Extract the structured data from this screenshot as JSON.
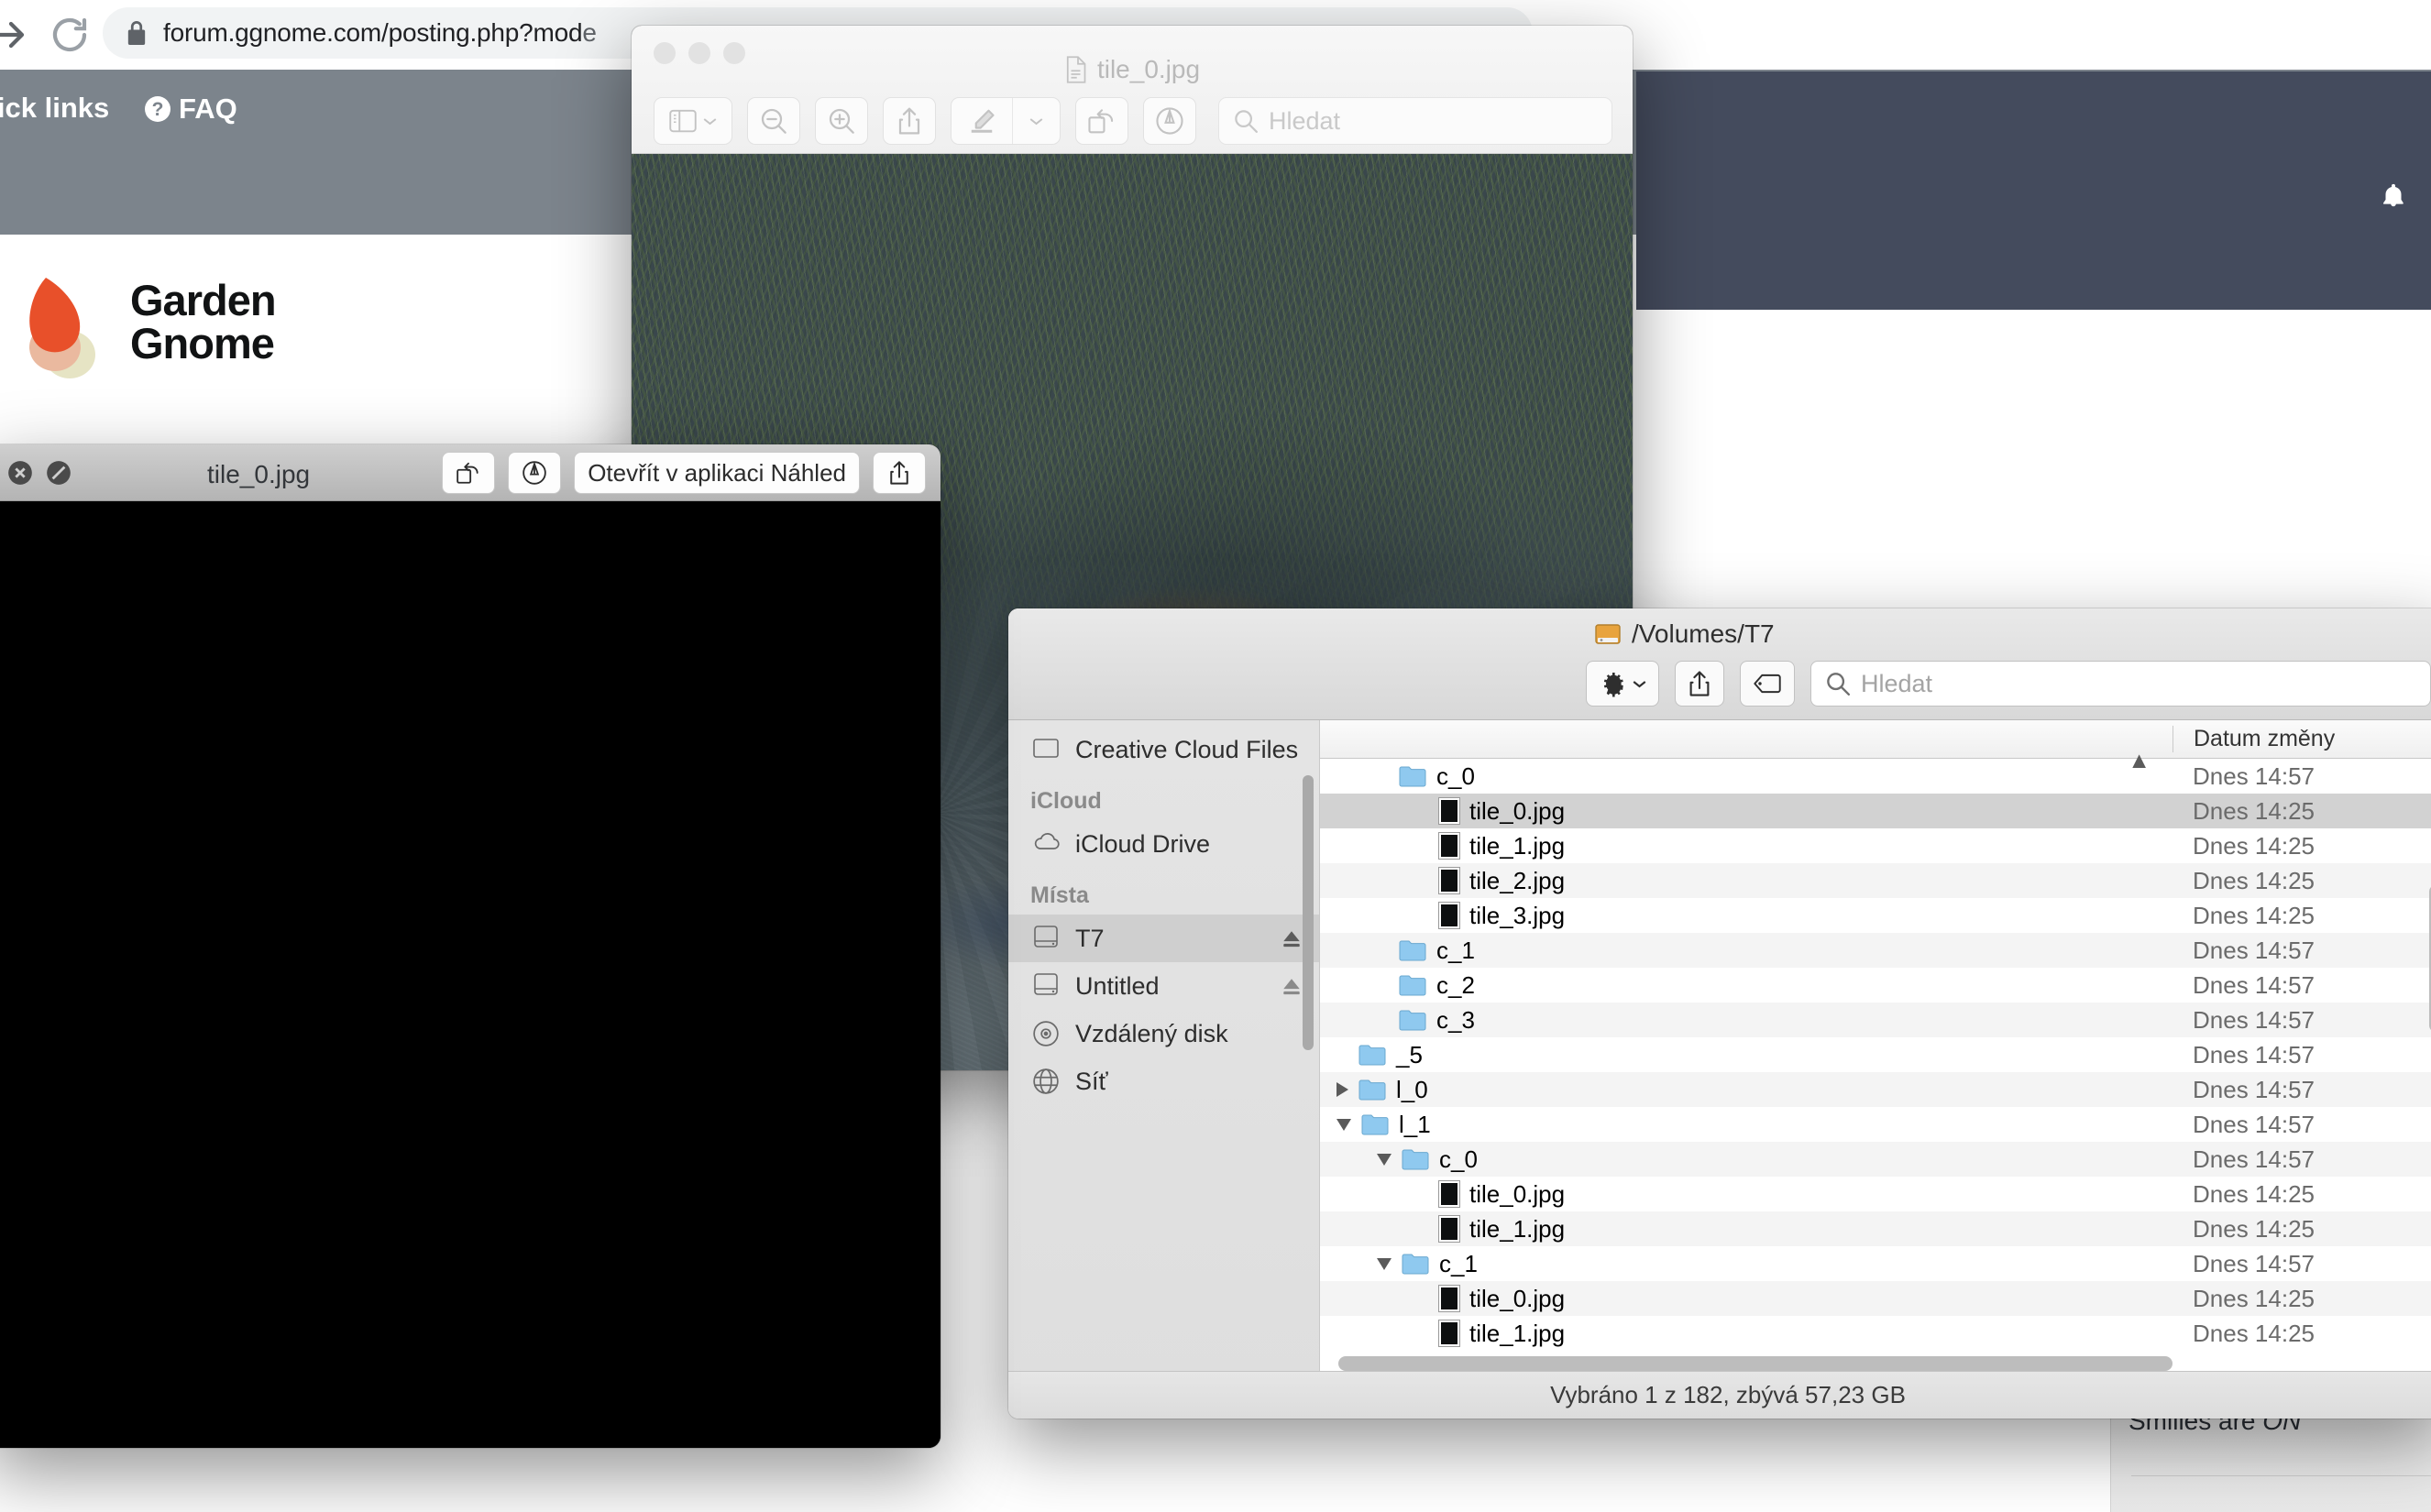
{
  "browser": {
    "url_bold": "forum.ggnome.com/posting.php?mod",
    "url_dim": "e",
    "lock_icon": "lock-icon",
    "forward_icon": "forward-arrow-icon",
    "reload_icon": "reload-icon"
  },
  "forum": {
    "quick_links": "uick links",
    "faq": "FAQ",
    "faq_badge": "?",
    "brand_line1": "Garden",
    "brand_line2": "Gnome",
    "bell_icon": "bell-icon",
    "smilies_prefix": "Smilies are ",
    "smilies_state": "ON"
  },
  "preview": {
    "title": "tile_0.jpg",
    "doc_icon": "document-icon",
    "traffic_lights": [
      "close",
      "minimize",
      "zoom"
    ],
    "toolbar": [
      {
        "name": "sidebar-view-button",
        "icon": "sidebar-icon",
        "caret": true
      },
      {
        "name": "zoom-out-button",
        "icon": "magnifier-minus-icon",
        "caret": false
      },
      {
        "name": "zoom-in-button",
        "icon": "magnifier-plus-icon",
        "caret": false
      },
      {
        "name": "share-button",
        "icon": "share-icon",
        "caret": false
      },
      {
        "name": "markup-button",
        "icon": "markup-pen-icon",
        "caret": true
      },
      {
        "name": "rotate-button",
        "icon": "rotate-left-icon",
        "caret": false
      },
      {
        "name": "annotate-button",
        "icon": "annotate-circle-icon",
        "caret": false
      }
    ],
    "search_placeholder": "Hledat",
    "search_icon": "search-icon"
  },
  "quicklook": {
    "title": "tile_0.jpg",
    "close_icon": "close-icon",
    "fullscreen_icon": "no-entry-icon",
    "rotate_icon": "rotate-left-icon",
    "markup_icon": "markup-pen-icon",
    "open_button": "Otevřít v aplikaci Náhled",
    "share_icon": "share-icon"
  },
  "finder": {
    "title": "/Volumes/T7",
    "drive_icon": "external-drive-icon",
    "toolbar": [
      {
        "name": "action-gear-button",
        "icon": "gear-icon",
        "caret": true
      },
      {
        "name": "share-button",
        "icon": "share-icon",
        "caret": false
      },
      {
        "name": "tag-button",
        "icon": "tag-icon",
        "caret": false
      }
    ],
    "search_placeholder": "Hledat",
    "search_icon": "search-icon",
    "columns": {
      "name": "",
      "name_sort_arrow": "▲",
      "date": "Datum změny"
    },
    "sidebar": [
      {
        "section": null,
        "label": "Creative Cloud Files",
        "icon": "folder-plain-icon",
        "selected": false,
        "eject": false
      },
      {
        "section": "iCloud",
        "label": null,
        "icon": null,
        "selected": false,
        "eject": false
      },
      {
        "section": null,
        "label": "iCloud Drive",
        "icon": "cloud-icon",
        "selected": false,
        "eject": false
      },
      {
        "section": "Místa",
        "label": null,
        "icon": null,
        "selected": false,
        "eject": false
      },
      {
        "section": null,
        "label": "T7",
        "icon": "drive-icon",
        "selected": true,
        "eject": true
      },
      {
        "section": null,
        "label": "Untitled",
        "icon": "drive-icon",
        "selected": false,
        "eject": true
      },
      {
        "section": null,
        "label": "Vzdálený disk",
        "icon": "disc-icon",
        "selected": false,
        "eject": false
      },
      {
        "section": null,
        "label": "Síť",
        "icon": "globe-icon",
        "selected": false,
        "eject": false
      }
    ],
    "rows": [
      {
        "name": "c_0",
        "date": "Dnes 14:57",
        "kind": "folder",
        "indent": 1,
        "twisty": "none",
        "selected": false
      },
      {
        "name": "tile_0.jpg",
        "date": "Dnes 14:25",
        "kind": "jpg",
        "indent": 2,
        "twisty": "none",
        "selected": true
      },
      {
        "name": "tile_1.jpg",
        "date": "Dnes 14:25",
        "kind": "jpg",
        "indent": 2,
        "twisty": "none",
        "selected": false
      },
      {
        "name": "tile_2.jpg",
        "date": "Dnes 14:25",
        "kind": "jpg",
        "indent": 2,
        "twisty": "none",
        "selected": false
      },
      {
        "name": "tile_3.jpg",
        "date": "Dnes 14:25",
        "kind": "jpg",
        "indent": 2,
        "twisty": "none",
        "selected": false
      },
      {
        "name": "c_1",
        "date": "Dnes 14:57",
        "kind": "folder",
        "indent": 1,
        "twisty": "none",
        "selected": false
      },
      {
        "name": "c_2",
        "date": "Dnes 14:57",
        "kind": "folder",
        "indent": 1,
        "twisty": "none",
        "selected": false
      },
      {
        "name": "c_3",
        "date": "Dnes 14:57",
        "kind": "folder",
        "indent": 1,
        "twisty": "none",
        "selected": false
      },
      {
        "name": "_5",
        "date": "Dnes 14:57",
        "kind": "folder",
        "indent": 0,
        "twisty": "none",
        "selected": false
      },
      {
        "name": "l_0",
        "date": "Dnes 14:57",
        "kind": "folder",
        "indent": 0,
        "twisty": "closed",
        "selected": false
      },
      {
        "name": "l_1",
        "date": "Dnes 14:57",
        "kind": "folder",
        "indent": 0,
        "twisty": "open",
        "selected": false
      },
      {
        "name": "c_0",
        "date": "Dnes 14:57",
        "kind": "folder",
        "indent": 1,
        "twisty": "open",
        "selected": false
      },
      {
        "name": "tile_0.jpg",
        "date": "Dnes 14:25",
        "kind": "jpg",
        "indent": 2,
        "twisty": "none",
        "selected": false
      },
      {
        "name": "tile_1.jpg",
        "date": "Dnes 14:25",
        "kind": "jpg",
        "indent": 2,
        "twisty": "none",
        "selected": false
      },
      {
        "name": "c_1",
        "date": "Dnes 14:57",
        "kind": "folder",
        "indent": 1,
        "twisty": "open",
        "selected": false
      },
      {
        "name": "tile_0.jpg",
        "date": "Dnes 14:25",
        "kind": "jpg",
        "indent": 2,
        "twisty": "none",
        "selected": false
      },
      {
        "name": "tile_1.jpg",
        "date": "Dnes 14:25",
        "kind": "jpg",
        "indent": 2,
        "twisty": "none",
        "selected": false
      }
    ],
    "status": "Vybráno 1 z 182, zbývá 57,23 GB"
  },
  "colors": {
    "forum_nav": "#7c848c",
    "forum_dark": "#444b5d",
    "brand_red": "#e8502a",
    "brand_skin": "#eab99f",
    "brand_cream": "#e6e4c4",
    "finder_selection": "#d2d2d2"
  }
}
